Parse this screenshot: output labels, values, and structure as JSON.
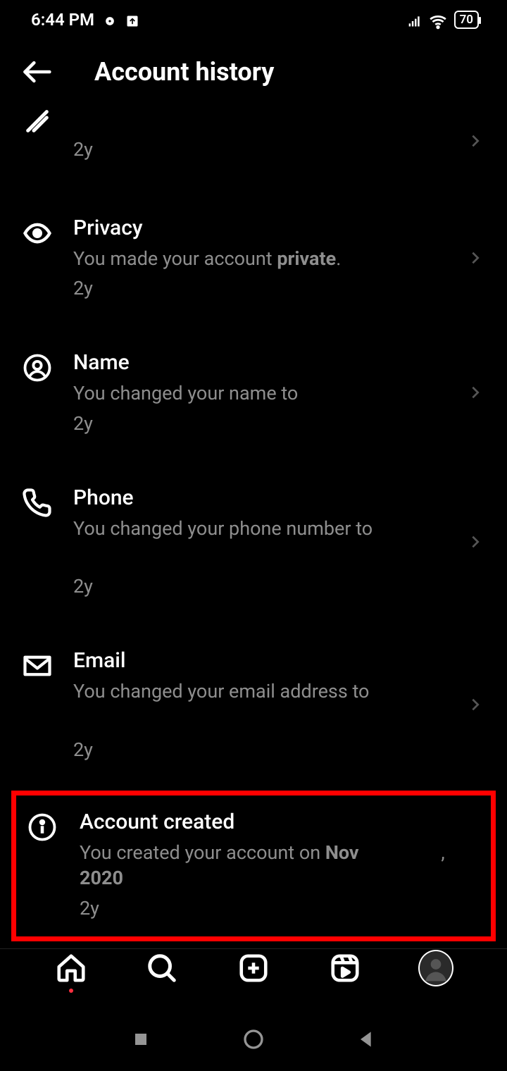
{
  "status": {
    "time": "6:44 PM",
    "battery": "70"
  },
  "header": {
    "title": "Account history"
  },
  "rows": {
    "r0": {
      "time": "2y"
    },
    "privacy": {
      "title": "Privacy",
      "desc_pre": "You made your account ",
      "desc_bold": "private",
      "desc_post": ".",
      "time": "2y"
    },
    "name": {
      "title": "Name",
      "desc": "You changed your name to",
      "time": "2y"
    },
    "phone": {
      "title": "Phone",
      "desc": "You changed your phone number to",
      "time": "2y"
    },
    "email": {
      "title": "Email",
      "desc": "You changed your email address to",
      "time": "2y"
    },
    "created": {
      "title": "Account created",
      "desc_pre": "You created your account on ",
      "desc_bold": "Nov",
      "desc_post_bold": "2020",
      "time": "2y"
    }
  }
}
